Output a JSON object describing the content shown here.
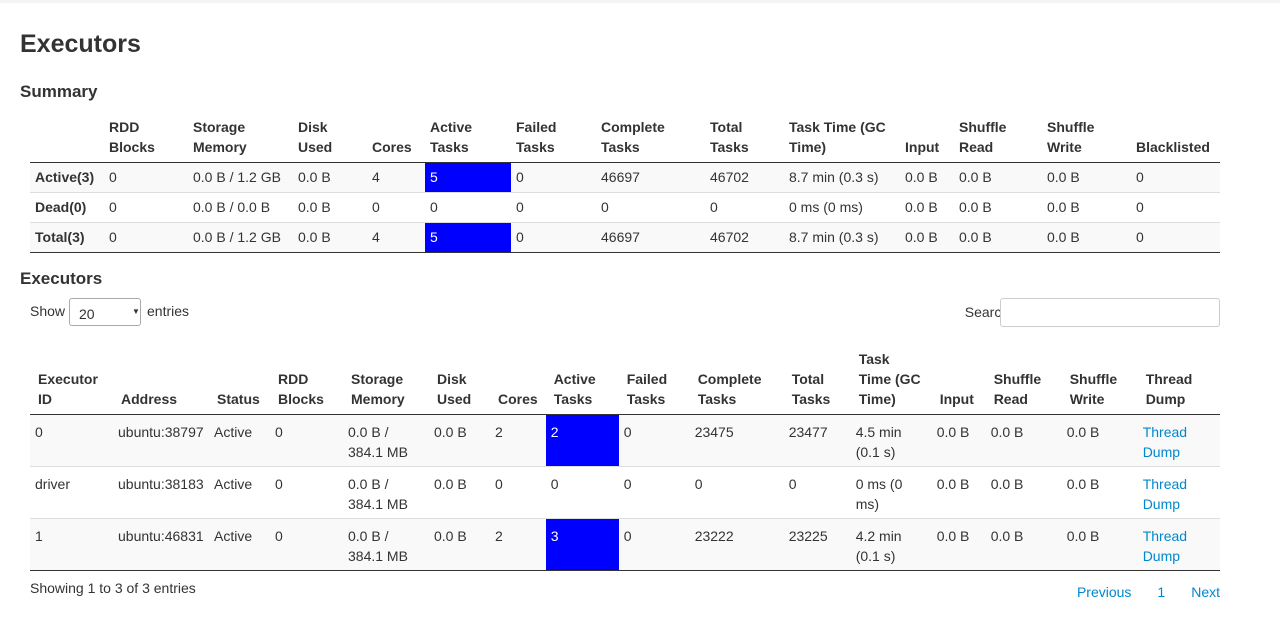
{
  "page_title": "Executors",
  "summary": {
    "title": "Summary",
    "headers": [
      "",
      "RDD Blocks",
      "Storage Memory",
      "Disk Used",
      "Cores",
      "Active Tasks",
      "Failed Tasks",
      "Complete Tasks",
      "Total Tasks",
      "Task Time (GC Time)",
      "Input",
      "Shuffle Read",
      "Shuffle Write",
      "Blacklisted"
    ],
    "rows": [
      [
        "Active(3)",
        "0",
        "0.0 B / 1.2 GB",
        "0.0 B",
        "4",
        "5",
        "0",
        "46697",
        "46702",
        "8.7 min (0.3 s)",
        "0.0 B",
        "0.0 B",
        "0.0 B",
        "0"
      ],
      [
        "Dead(0)",
        "0",
        "0.0 B / 0.0 B",
        "0.0 B",
        "0",
        "0",
        "0",
        "0",
        "0",
        "0 ms (0 ms)",
        "0.0 B",
        "0.0 B",
        "0.0 B",
        "0"
      ],
      [
        "Total(3)",
        "0",
        "0.0 B / 1.2 GB",
        "0.0 B",
        "4",
        "5",
        "0",
        "46697",
        "46702",
        "8.7 min (0.3 s)",
        "0.0 B",
        "0.0 B",
        "0.0 B",
        "0"
      ]
    ]
  },
  "executors": {
    "title": "Executors",
    "show_label": "Show",
    "page_size": "20",
    "entries_label": "entries",
    "search_label": "Search:",
    "search_value": "",
    "headers": [
      "Executor ID",
      "Address",
      "Status",
      "RDD Blocks",
      "Storage Memory",
      "Disk Used",
      "Cores",
      "Active Tasks",
      "Failed Tasks",
      "Complete Tasks",
      "Total Tasks",
      "Task Time (GC Time)",
      "Input",
      "Shuffle Read",
      "Shuffle Write",
      "Thread Dump"
    ],
    "rows": [
      [
        "0",
        "ubuntu:38797",
        "Active",
        "0",
        "0.0 B / 384.1 MB",
        "0.0 B",
        "2",
        "2",
        "0",
        "23475",
        "23477",
        "4.5 min (0.1 s)",
        "0.0 B",
        "0.0 B",
        "0.0 B",
        "Thread Dump"
      ],
      [
        "driver",
        "ubuntu:38183",
        "Active",
        "0",
        "0.0 B / 384.1 MB",
        "0.0 B",
        "0",
        "0",
        "0",
        "0",
        "0",
        "0 ms (0 ms)",
        "0.0 B",
        "0.0 B",
        "0.0 B",
        "Thread Dump"
      ],
      [
        "1",
        "ubuntu:46831",
        "Active",
        "0",
        "0.0 B / 384.1 MB",
        "0.0 B",
        "2",
        "3",
        "0",
        "23222",
        "23225",
        "4.2 min (0.1 s)",
        "0.0 B",
        "0.0 B",
        "0.0 B",
        "Thread Dump"
      ]
    ],
    "info": "Showing 1 to 3 of 3 entries",
    "pagination": {
      "previous": "Previous",
      "page": "1",
      "next": "Next"
    }
  },
  "colors": {
    "active_tasks_highlight": "#0000ff",
    "link": "#0088cc"
  }
}
